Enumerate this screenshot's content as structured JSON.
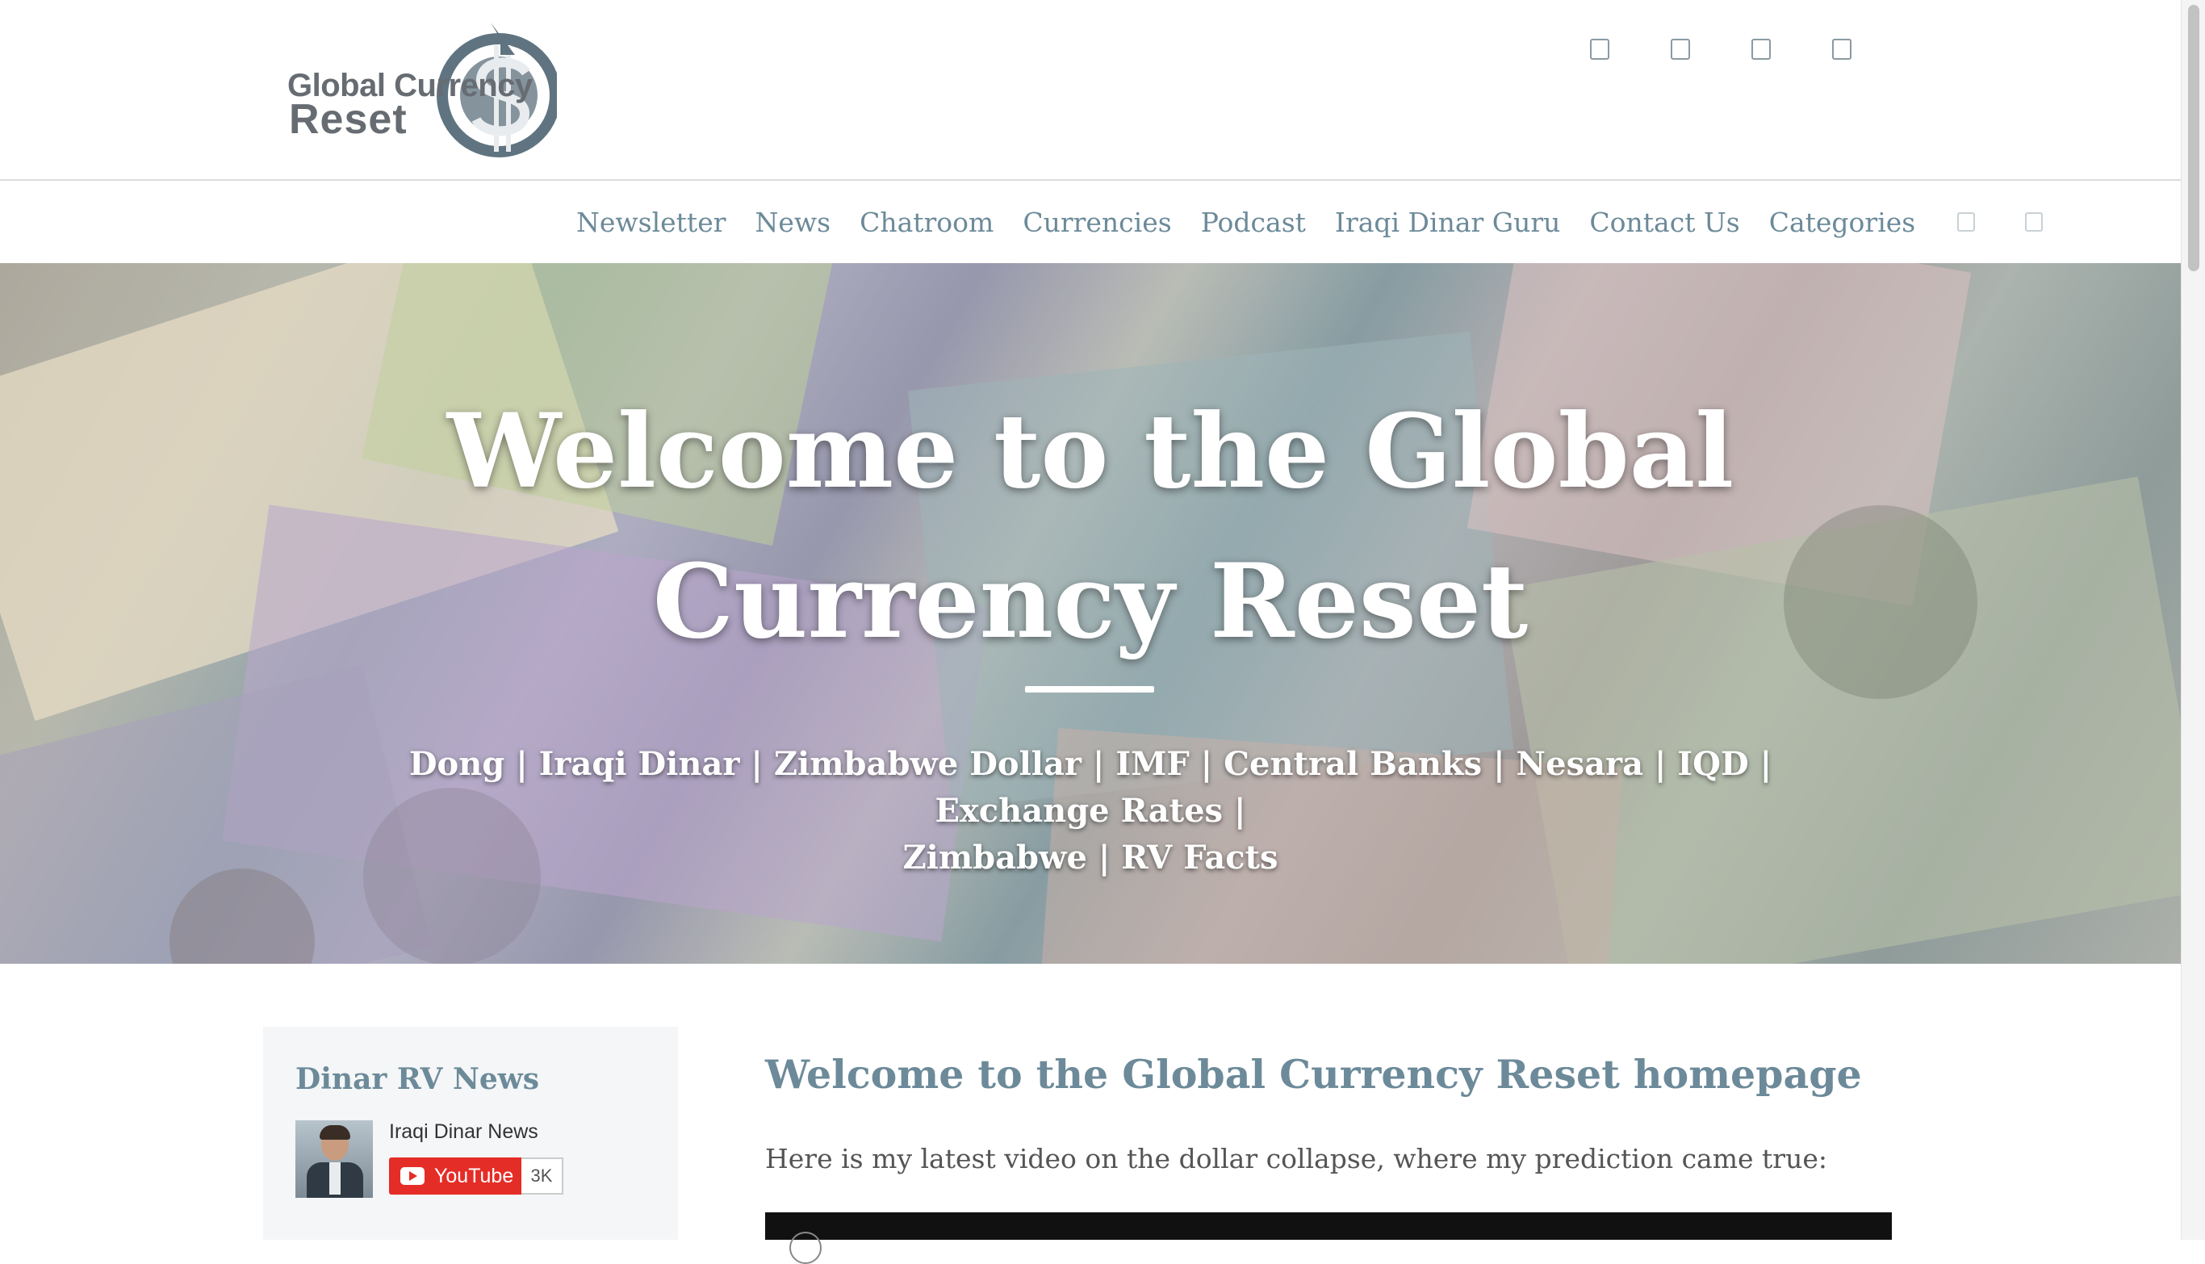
{
  "logo": {
    "line1": "Global Currency",
    "line2": "Reset",
    "symbol": "dollar-globe-icon"
  },
  "social_icons": [
    "social-icon-1",
    "social-icon-2",
    "social-icon-3",
    "social-icon-4"
  ],
  "nav": {
    "items": [
      {
        "label": "Newsletter"
      },
      {
        "label": "News"
      },
      {
        "label": "Chatroom"
      },
      {
        "label": "Currencies"
      },
      {
        "label": "Podcast"
      },
      {
        "label": "Iraqi Dinar Guru"
      },
      {
        "label": "Contact Us"
      },
      {
        "label": "Categories"
      }
    ],
    "icons": [
      "search-icon",
      "menu-icon"
    ]
  },
  "hero": {
    "title_line1": "Welcome to the Global",
    "title_line2": "Currency Reset",
    "subtitle_line1": "Dong | Iraqi Dinar | Zimbabwe Dollar | IMF | Central Banks | Nesara | IQD | Exchange Rates |",
    "subtitle_line2": "Zimbabwe | RV Facts"
  },
  "sidebar": {
    "title": "Dinar RV News",
    "channel_name": "Iraqi Dinar News",
    "youtube_label": "YouTube",
    "subscriber_count": "3K"
  },
  "main": {
    "title": "Welcome to the Global Currency Reset homepage",
    "intro": "Here is my latest video on the dollar collapse, where my prediction came true:"
  },
  "colors": {
    "accent": "#6c8a99",
    "youtube_red": "#e52d27",
    "hero_text": "#ffffff"
  }
}
